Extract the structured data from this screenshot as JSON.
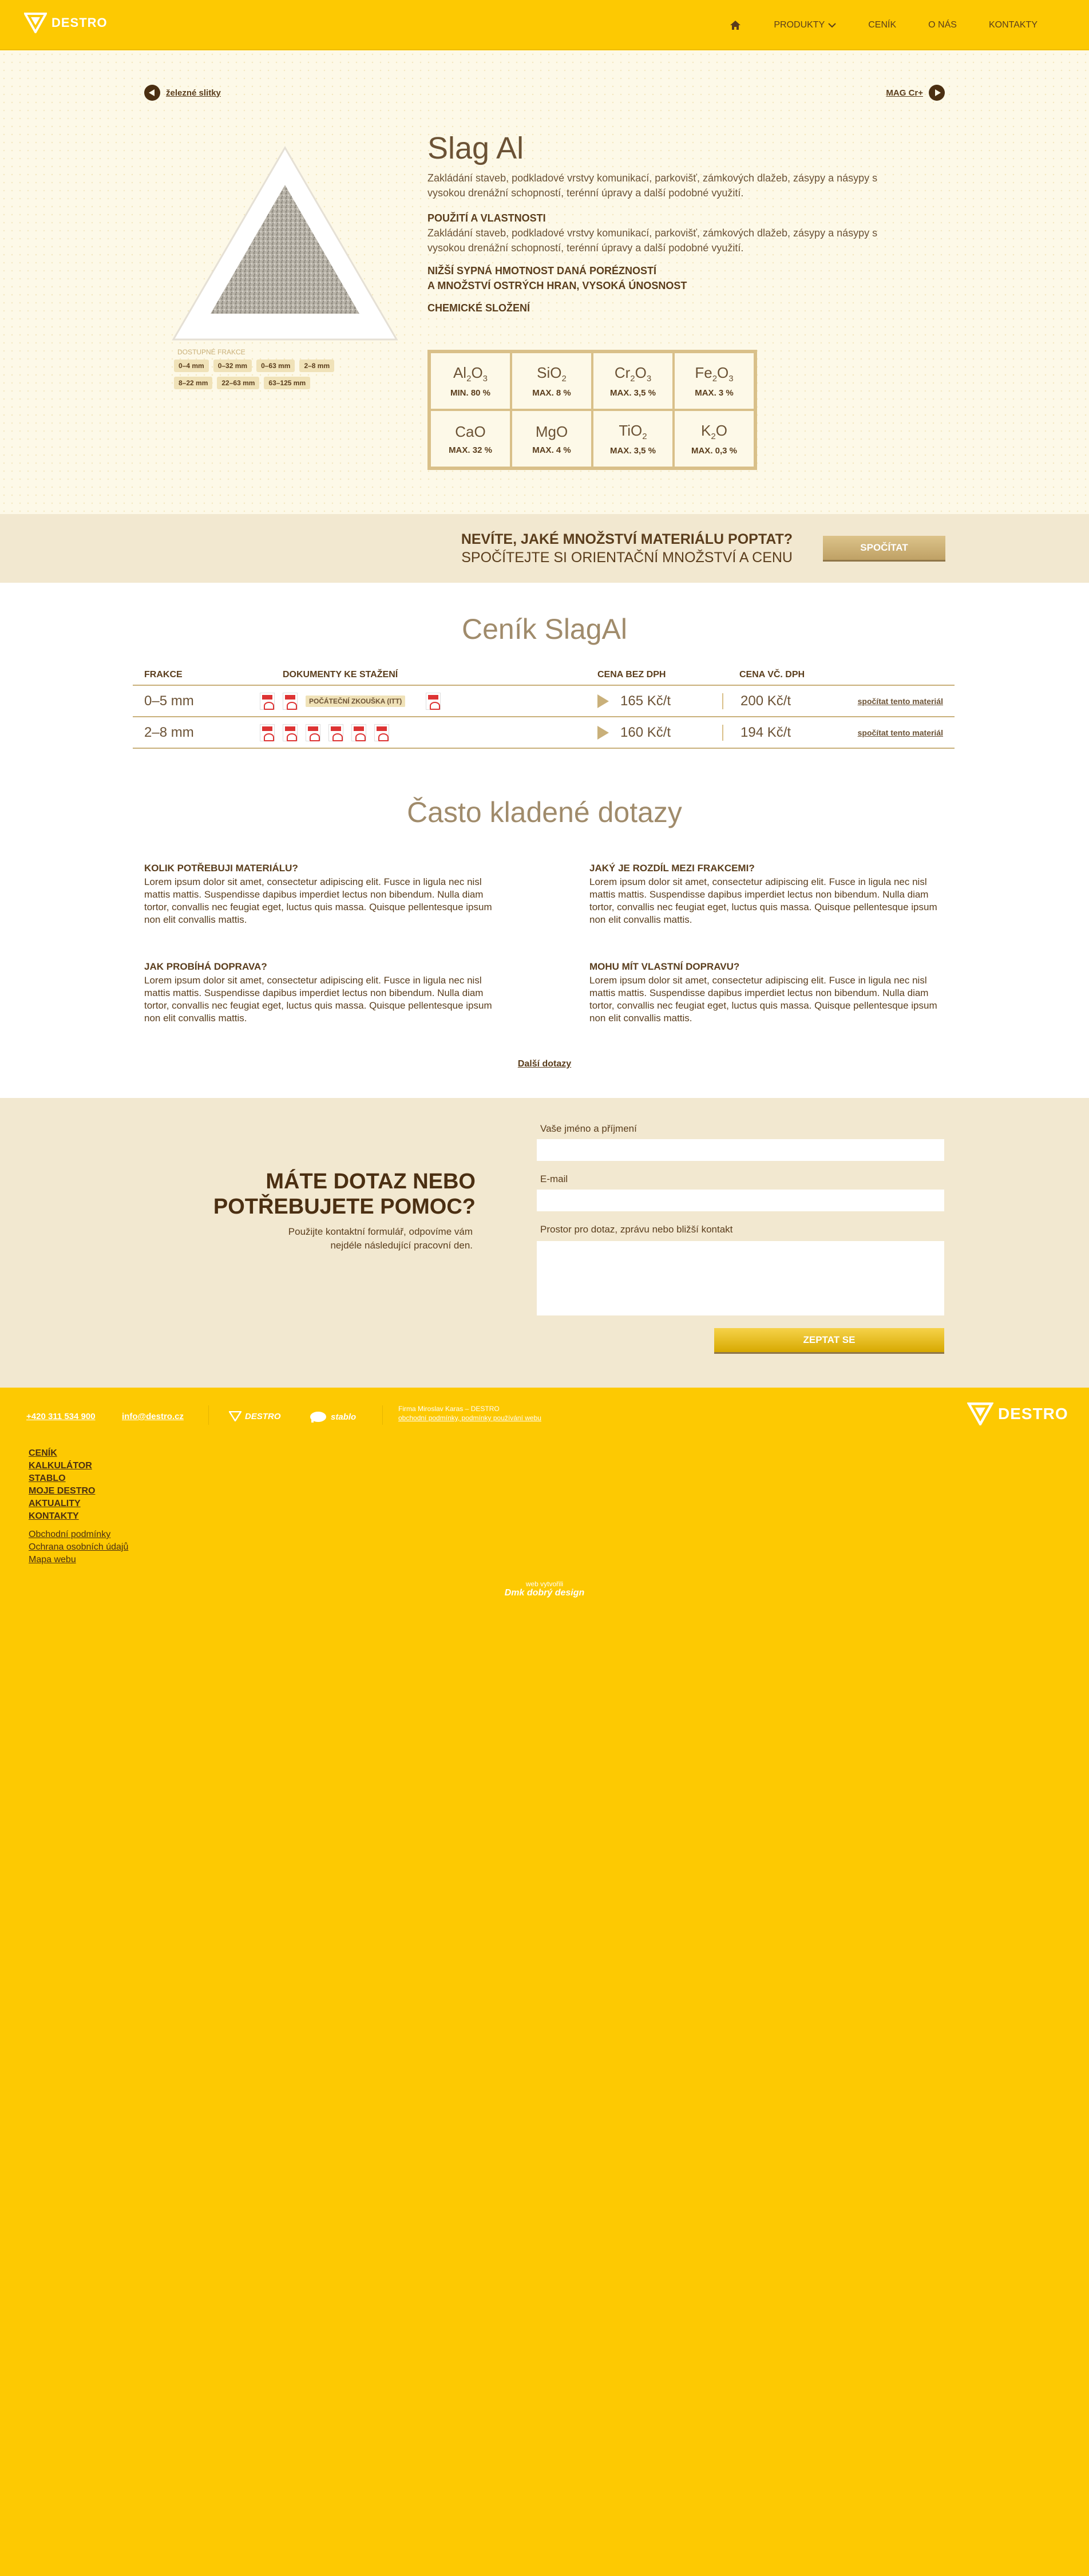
{
  "header": {
    "logo_text": "DESTRO",
    "nav": [
      {
        "label": "PRODUKTY"
      },
      {
        "label": "CENÍK"
      },
      {
        "label": "O NÁS"
      },
      {
        "label": "KONTAKTY"
      }
    ]
  },
  "product": {
    "prev_label": "železné slitky",
    "next_label": "MAG Cr+",
    "title": "Slag Al",
    "description": "Zakládání staveb, podkladové vrstvy komunikací, parkovišť, zámkových dlažeb, zásypy a násypy s vysokou drenážní schopností, terénní úpravy a další podobné využití.",
    "usage_heading": "POUŽITÍ A VLASTNOSTI",
    "usage_text": "Zakládání staveb, podkladové vrstvy komunikací, parkovišť, zámkových dlažeb, zásypy a násypy s vysokou drenážní schopností, terénní úpravy a další podobné využití.",
    "feature_line1": "NIŽŠÍ SYPNÁ HMOTNOST DANÁ PORÉZNOSTÍ",
    "feature_line2": "A MNOŽSTVÍ OSTRÝCH HRAN, VYSOKÁ ÚNOSNOST",
    "chem_heading": "CHEMICKÉ SLOŽENÍ",
    "fractions_label": "dostupné frakce",
    "fractions": [
      "0–4 mm",
      "0–32 mm",
      "0–63 mm",
      "2–8 mm",
      "8–22 mm",
      "22–63 mm",
      "63–125 mm"
    ],
    "chemistry": [
      {
        "el": "Al",
        "sub": "2",
        "el2": "O",
        "sub2": "3",
        "value": "MIN. 80 %"
      },
      {
        "el": "SiO",
        "sub": "2",
        "el2": "",
        "sub2": "",
        "value": "MAX. 8 %"
      },
      {
        "el": "Cr",
        "sub": "2",
        "el2": "O",
        "sub2": "3",
        "value": "MAX. 3,5 %"
      },
      {
        "el": "Fe",
        "sub": "2",
        "el2": "O",
        "sub2": "3",
        "value": "MAX. 3 %"
      },
      {
        "el": "CaO",
        "sub": "",
        "el2": "",
        "sub2": "",
        "value": "MAX. 32 %"
      },
      {
        "el": "MgO",
        "sub": "",
        "el2": "",
        "sub2": "",
        "value": "MAX. 4 %"
      },
      {
        "el": "TiO",
        "sub": "2",
        "el2": "",
        "sub2": "",
        "value": "MAX. 3,5 %"
      },
      {
        "el": "K",
        "sub": "2",
        "el2": "O",
        "sub2": "",
        "value": "MAX. 0,3 %"
      }
    ]
  },
  "cta": {
    "question": "NEVÍTE, JAKÉ MNOŽSTVÍ MATERIÁLU POPTAT?",
    "sub": "SPOČÍTEJTE SI ORIENTAČNÍ MNOŽSTVÍ A CENU",
    "button": "SPOČÍTAT"
  },
  "pricelist": {
    "title": "Ceník SlagAl",
    "columns": [
      "FRAKCE",
      "DOKUMENTY KE STAŽENÍ",
      "CENA BEZ DPH",
      "CENA VČ. DPH"
    ],
    "rows": [
      {
        "fraction": "0–5 mm",
        "doc_label": "POČÁTEČNÍ ZKOUŠKA (ITT)",
        "price": "165 Kč/t",
        "price_vat": "200 Kč/t",
        "action": "spočítat tento materiál"
      },
      {
        "fraction": "2–8 mm",
        "doc_label": "",
        "price": "160 Kč/t",
        "price_vat": "194 Kč/t",
        "action": "spočítat tento materiál"
      }
    ]
  },
  "faq": {
    "title": "Často kladené dotazy",
    "items": [
      {
        "q": "KOLIK POTŘEBUJI MATERIÁLU?",
        "a": "Lorem ipsum dolor sit amet, consectetur adipiscing elit. Fusce in ligula nec nisl mattis mattis. Suspendisse dapibus imperdiet lectus non bibendum. Nulla diam tortor, convallis nec feugiat eget, luctus quis massa. Quisque pellentesque ipsum non elit convallis mattis."
      },
      {
        "q": "JAKÝ JE ROZDÍL MEZI FRAKCEMI?",
        "a": "Lorem ipsum dolor sit amet, consectetur adipiscing elit. Fusce in ligula nec nisl mattis mattis. Suspendisse dapibus imperdiet lectus non bibendum. Nulla diam tortor, convallis nec feugiat eget, luctus quis massa. Quisque pellentesque ipsum non elit convallis mattis."
      },
      {
        "q": "JAK PROBÍHÁ DOPRAVA?",
        "a": "Lorem ipsum dolor sit amet, consectetur adipiscing elit. Fusce in ligula nec nisl mattis mattis. Suspendisse dapibus imperdiet lectus non bibendum. Nulla diam tortor, convallis nec feugiat eget, luctus quis massa. Quisque pellentesque ipsum non elit convallis mattis."
      },
      {
        "q": "MOHU MÍT VLASTNÍ DOPRAVU?",
        "a": "Lorem ipsum dolor sit amet, consectetur adipiscing elit. Fusce in ligula nec nisl mattis mattis. Suspendisse dapibus imperdiet lectus non bibendum. Nulla diam tortor, convallis nec feugiat eget, luctus quis massa. Quisque pellentesque ipsum non elit convallis mattis."
      }
    ],
    "more": "Další dotazy"
  },
  "contact": {
    "title1": "MÁTE DOTAZ NEBO",
    "title2": "POTŘEBUJETE POMOC?",
    "subtitle": "Použijte kontaktní formulář, odpovíme vám nejdéle následující pracovní den.",
    "name_label": "Vaše jméno a příjmení",
    "email_label": "E-mail",
    "message_label": "Prostor pro dotaz, zprávu nebo bližší kontakt",
    "submit": "ZEPTAT SE"
  },
  "footer": {
    "phone": "+420 311 534 900",
    "email": "info@destro.cz",
    "partner1": "DESTRO",
    "partner2": "stablo",
    "address": "Firma Miroslav Karas – DESTRO",
    "terms_link": "obchodní podmínky, podmínky používání webu",
    "logo_text": "DESTRO",
    "menu": [
      "CENÍK",
      "KALKULÁTOR",
      "STABLO",
      "MOJE DESTRO",
      "AKTUALITY",
      "KONTAKTY"
    ],
    "links": [
      "Obchodní podmínky",
      "Ochrana osobních údajů",
      "Mapa webu"
    ],
    "made_by": "web vytvořili",
    "agency": "Dmk dobrý design"
  },
  "colors": {
    "brand_yellow": "#fdc902",
    "brown": "#5a3d1c",
    "beige": "#f2e8d0"
  }
}
